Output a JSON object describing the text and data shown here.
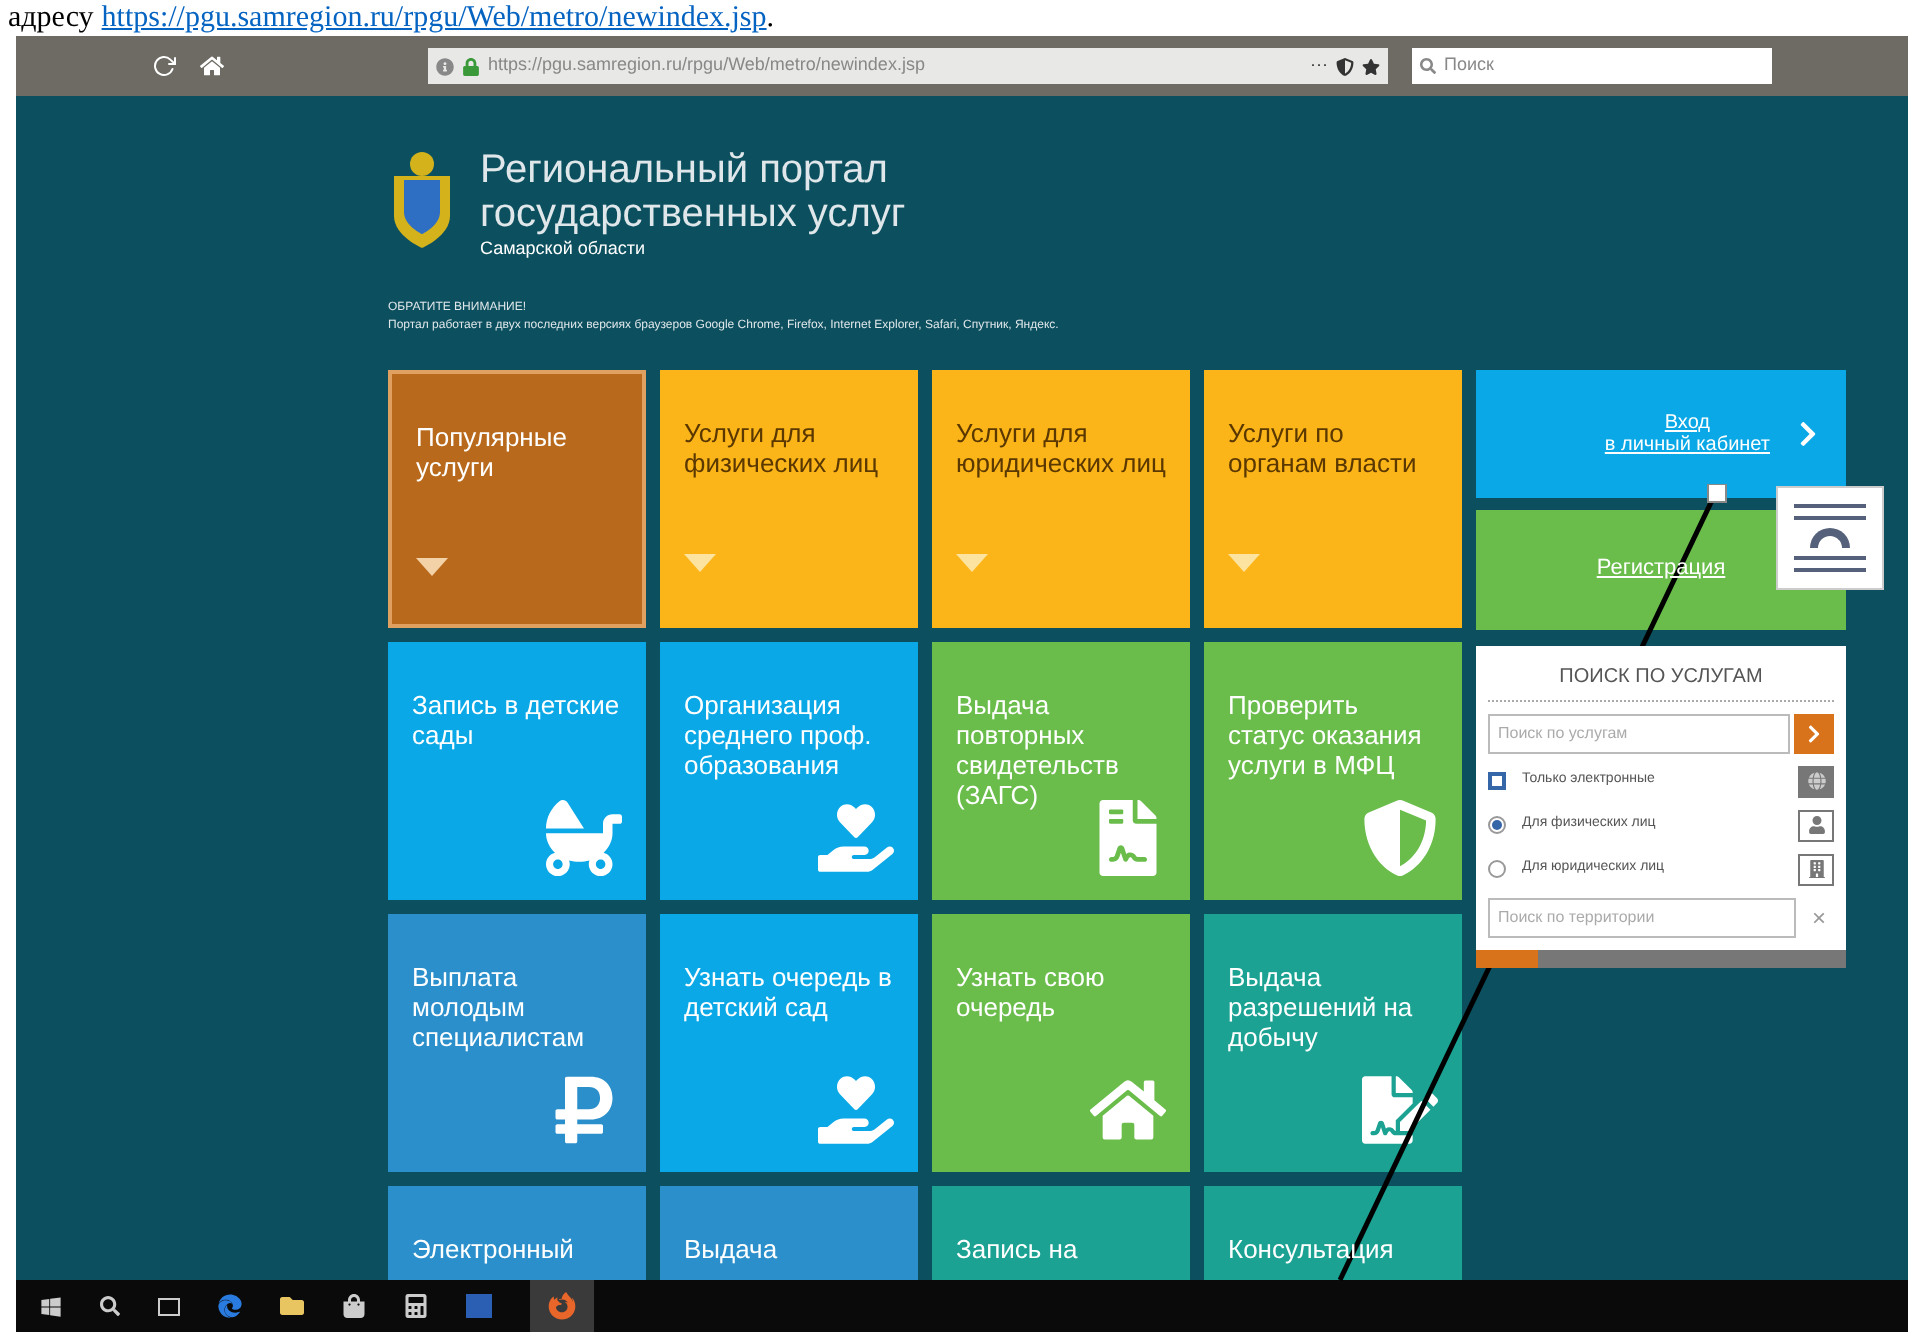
{
  "document_text": {
    "prefix": "адресу",
    "link": "https://pgu.samregion.ru/rpgu/Web/metro/newindex.jsp",
    "suffix": "."
  },
  "browser": {
    "url": "https://pgu.samregion.ru/rpgu/Web/metro/newindex.jsp",
    "menu_dots": "···",
    "search_placeholder": "Поиск"
  },
  "portal": {
    "title_line_1": "Региональный портал",
    "title_line_2": "государственных услуг",
    "subtitle": "Самарской области"
  },
  "notice": {
    "heading": "ОБРАТИТЕ ВНИМАНИЕ!",
    "text": "Портал работает в двух последних версиях браузеров Google Chrome, Firefox, Internet Explorer, Safari, Спутник, Яндекс."
  },
  "tiles": [
    {
      "kind": "category",
      "label": "Популярные услуги",
      "selected": true,
      "color": "#b8691c"
    },
    {
      "kind": "category",
      "label": "Услуги для физических лиц",
      "selected": false,
      "color": "#fbb519"
    },
    {
      "kind": "category",
      "label": "Услуги для юридических лиц",
      "selected": false,
      "color": "#fbb519"
    },
    {
      "kind": "category",
      "label": "Услуги по органам власти",
      "selected": false,
      "color": "#fbb519"
    },
    {
      "kind": "service",
      "label": "Запись в детские сады",
      "color": "#0aa8e6"
    },
    {
      "kind": "service",
      "label": "Организация среднего проф. образования",
      "color": "#0aa8e6"
    },
    {
      "kind": "service",
      "label": "Выдача повторных свидетельств (ЗАГС)",
      "color": "#6abd4b"
    },
    {
      "kind": "service",
      "label": "Проверить статус оказания услуги в МФЦ",
      "color": "#6abd4b"
    },
    {
      "kind": "service",
      "label": "Выплата молодым специалистам",
      "color": "#2a8fcb"
    },
    {
      "kind": "service",
      "label": "Узнать очередь в детский сад",
      "color": "#0aa8e6"
    },
    {
      "kind": "service",
      "label": "Узнать свою очередь",
      "color": "#6abd4b"
    },
    {
      "kind": "service",
      "label": "Выдача разрешений на добычу",
      "color": "#1ba293"
    },
    {
      "kind": "service",
      "label": "Электронный",
      "color": "#2a8fcb"
    },
    {
      "kind": "service",
      "label": "Выдача",
      "color": "#2a8fcb"
    },
    {
      "kind": "service",
      "label": "Запись на",
      "color": "#1ba293"
    },
    {
      "kind": "service",
      "label": "Консультация",
      "color": "#1ba293"
    }
  ],
  "login": {
    "line_1": "Вход",
    "line_2": "в личный кабинет"
  },
  "registration": {
    "label": "Регистрация"
  },
  "service_search": {
    "heading": "ПОИСК ПО УСЛУГАМ",
    "placeholder": "Поиск по услугам",
    "electronic_only": {
      "label": "Только электронные",
      "checked": false
    },
    "audience": [
      {
        "label": "Для физических лиц",
        "selected": true
      },
      {
        "label": "Для юридических лиц",
        "selected": false
      }
    ],
    "territory_placeholder": "Поиск по территории",
    "clear": "×",
    "level": 0.17
  }
}
